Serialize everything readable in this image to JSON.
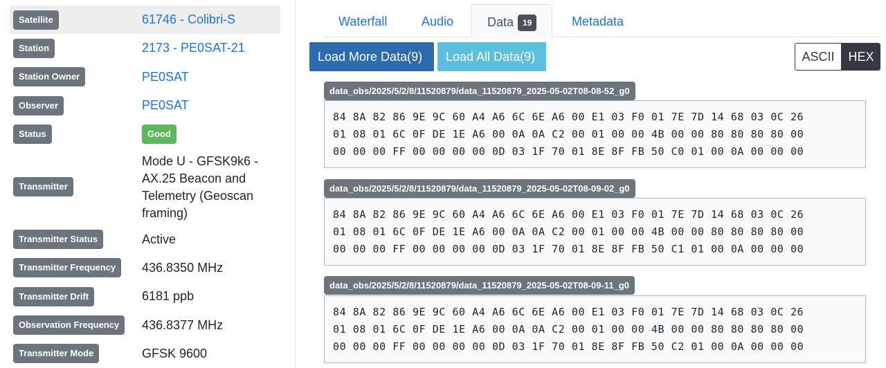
{
  "details": [
    {
      "label": "Satellite",
      "value": "61746 - Colibri-S",
      "type": "link"
    },
    {
      "label": "Station",
      "value": "2173 - PE0SAT-21",
      "type": "link"
    },
    {
      "label": "Station Owner",
      "value": "PE0SAT",
      "type": "link"
    },
    {
      "label": "Observer",
      "value": "PE0SAT",
      "type": "link"
    },
    {
      "label": "Status",
      "value": "Good",
      "type": "badge",
      "color": "#5cb85c"
    },
    {
      "label": "Transmitter",
      "value_lines": [
        "Mode U - GFSK9k6 -",
        "AX.25 Beacon and",
        "Telemetry (Geoscan",
        "framing)"
      ],
      "type": "text"
    },
    {
      "label": "Transmitter Status",
      "value": "Active",
      "type": "text"
    },
    {
      "label": "Transmitter Frequency",
      "value": "436.8350 MHz",
      "type": "text"
    },
    {
      "label": "Transmitter Drift",
      "value": "6181 ppb",
      "type": "text"
    },
    {
      "label": "Observation Frequency",
      "value": "436.8377 MHz",
      "type": "text"
    },
    {
      "label": "Transmitter Mode",
      "value": "GFSK 9600",
      "type": "text"
    }
  ],
  "tabs": {
    "waterfall": "Waterfall",
    "audio": "Audio",
    "data": "Data",
    "data_count": "19",
    "metadata": "Metadata",
    "active": "Data"
  },
  "actions": {
    "load_more": "Load More Data(9)",
    "load_all": "Load All Data(9)",
    "ascii": "ASCII",
    "hex": "HEX",
    "selected_format": "HEX"
  },
  "frames": [
    {
      "filename": "data_obs/2025/5/2/8/11520879/data_11520879_2025-05-02T08-08-52_g0",
      "lines": [
        "84 8A 82 86 9E 9C 60 A4 A6 6C 6E A6 00 E1 03 F0 01 7E 7D 14 68 03 0C 26",
        "01 08 01 6C 0F DE 1E A6 00 0A 0A C2 00 01 00 00 4B 00 00 80 80 80 80 00",
        "00 00 00 FF 00 00 00 00 0D 03 1F 70 01 8E 8F FB 50 C0 01 00 0A 00 00 00"
      ]
    },
    {
      "filename": "data_obs/2025/5/2/8/11520879/data_11520879_2025-05-02T08-09-02_g0",
      "lines": [
        "84 8A 82 86 9E 9C 60 A4 A6 6C 6E A6 00 E1 03 F0 01 7E 7D 14 68 03 0C 26",
        "01 08 01 6C 0F DE 1E A6 00 0A 0A C2 00 01 00 00 4B 00 00 80 80 80 80 00",
        "00 00 00 FF 00 00 00 00 0D 03 1F 70 01 8E 8F FB 50 C1 01 00 0A 00 00 00"
      ]
    },
    {
      "filename": "data_obs/2025/5/2/8/11520879/data_11520879_2025-05-02T08-09-11_g0",
      "lines": [
        "84 8A 82 86 9E 9C 60 A4 A6 6C 6E A6 00 E1 03 F0 01 7E 7D 14 68 03 0C 26",
        "01 08 01 6C 0F DE 1E A6 00 0A 0A C2 00 01 00 00 4B 00 00 80 80 80 80 00",
        "00 00 00 FF 00 00 00 00 0D 03 1F 70 01 8E 8F FB 50 C2 01 00 0A 00 00 00"
      ]
    }
  ]
}
